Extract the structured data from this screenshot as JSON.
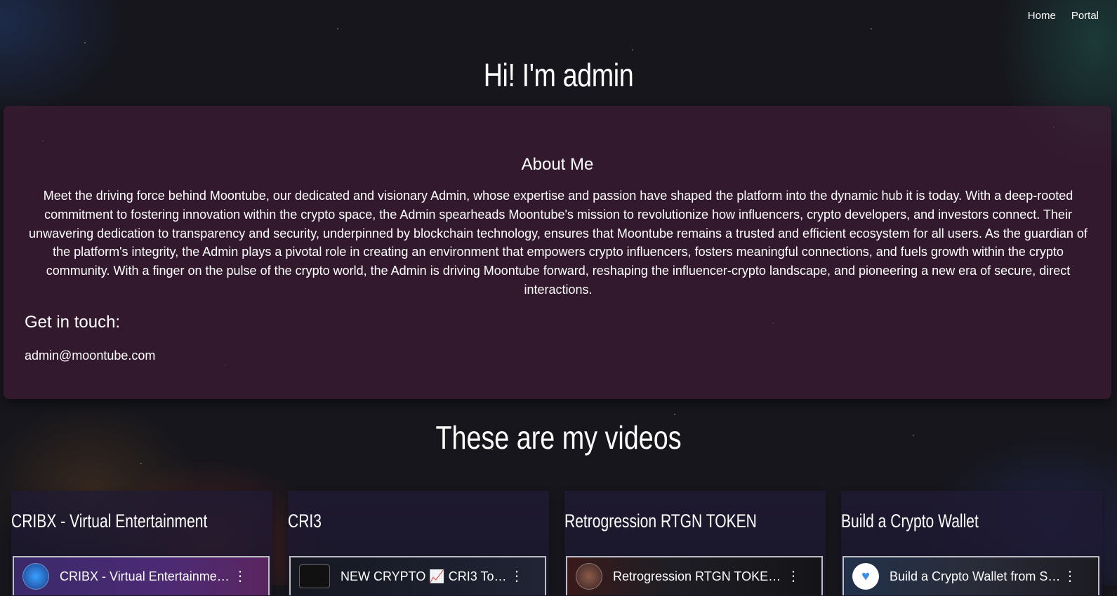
{
  "nav": {
    "home": "Home",
    "portal": "Portal"
  },
  "page_title": "Hi! I'm admin",
  "about": {
    "title": "About Me",
    "text": "Meet the driving force behind Moontube, our dedicated and visionary Admin, whose expertise and passion have shaped the platform into the dynamic hub it is today. With a deep-rooted commitment to fostering innovation within the crypto space, the Admin spearheads Moontube's mission to revolutionize how influencers, crypto developers, and investors connect. Their unwavering dedication to transparency and security, underpinned by blockchain technology, ensures that Moontube remains a trusted and efficient ecosystem for all users. As the guardian of the platform's integrity, the Admin plays a pivotal role in creating an environment that empowers crypto influencers, fosters meaningful connections, and fuels growth within the crypto community. With a finger on the pulse of the crypto world, the Admin is driving Moontube forward, reshaping the influencer-crypto landscape, and pioneering a new era of secure, direct interactions.",
    "contact_title": "Get in touch:",
    "email": "admin@moontube.com"
  },
  "videos": {
    "title": "These are my videos",
    "items": [
      {
        "title": "CRIBX - Virtual Entertainment",
        "embed_title": "CRIBX - Virtual Entertainmen...",
        "menu_icon": "more-vertical-icon"
      },
      {
        "title": "CRI3",
        "embed_title": "NEW CRYPTO 📈 CRI3 Token...",
        "menu_icon": "more-vertical-icon"
      },
      {
        "title": "Retrogression RTGN TOKEN",
        "embed_title": "Retrogression RTGN TOKEN t...",
        "menu_icon": "more-vertical-icon"
      },
      {
        "title": "Build a Crypto Wallet",
        "embed_title": "Build a Crypto Wallet from Sc...",
        "menu_icon": "more-vertical-icon"
      }
    ]
  }
}
